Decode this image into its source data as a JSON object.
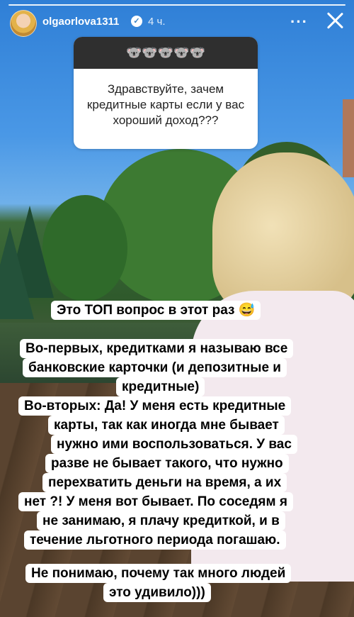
{
  "story": {
    "username": "olgaorlova1311",
    "time": "4 ч.",
    "verified_icon": "verified-badge-icon",
    "more_icon": "more-options-icon",
    "close_icon": "close-icon"
  },
  "question": {
    "emoji_header": "🐨🐨🐨🐨🐨",
    "text_lines": [
      "Здравствуйте, зачем",
      "кредитные карты если у вас",
      "хороший доход???"
    ]
  },
  "captions": [
    "Это ТОП вопрос в этот раз 😅",
    "Во-первых, кредитками я называю все",
    "банковские карточки (и депозитные и",
    "кредитные)",
    "Во-вторых: Да! У меня есть кредитные",
    "карты, так как иногда мне бывает",
    "нужно ими воспользоваться. У вас",
    "разве не бывает такого, что нужно",
    "перехватить деньги на время, а их",
    "нет ?! У меня вот бывает. По соседям я",
    "не занимаю, я плачу кредиткой, и в",
    "течение льготного периода погашаю.",
    "Не понимаю, почему так много людей",
    "это удивило)))"
  ]
}
